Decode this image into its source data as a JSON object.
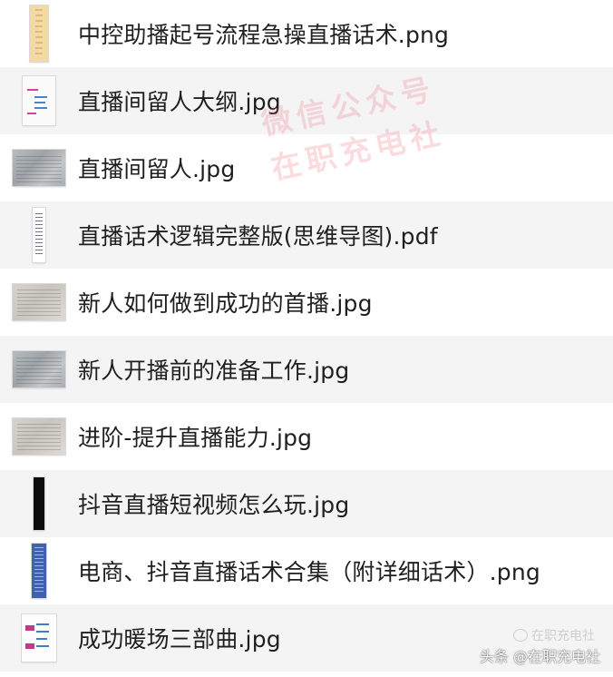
{
  "files": [
    {
      "name": "中控助播起号流程急操直播话术.png",
      "thumb": "tall-beige-icon"
    },
    {
      "name": "直播间留人大纲.jpg",
      "thumb": "mindmap-thumbnail-icon"
    },
    {
      "name": "直播间留人.jpg",
      "thumb": "photo-thumbnail-icon"
    },
    {
      "name": "直播话术逻辑完整版(思维导图).pdf",
      "thumb": "pdf-thumbnail-icon"
    },
    {
      "name": "新人如何做到成功的首播.jpg",
      "thumb": "photo-thumbnail-icon"
    },
    {
      "name": "新人开播前的准备工作.jpg",
      "thumb": "photo-thumbnail-icon"
    },
    {
      "name": "进阶-提升直播能力.jpg",
      "thumb": "photo-thumbnail-icon"
    },
    {
      "name": "抖音直播短视频怎么玩.jpg",
      "thumb": "black-thumbnail-icon"
    },
    {
      "name": "电商、抖音直播话术合集（附详细话术）.png",
      "thumb": "blue-thumbnail-icon"
    },
    {
      "name": "成功暖场三部曲.jpg",
      "thumb": "mindmap-thumbnail-icon"
    }
  ],
  "watermark": {
    "line1": "微信公众号",
    "line2": "在职充电社"
  },
  "credit": {
    "text": "头条 @在职充电社",
    "mark": "在职充电社"
  },
  "colors": {
    "row_alt": "#f4f4f5",
    "text": "#1f1f1f",
    "watermark": "#ee828c"
  }
}
